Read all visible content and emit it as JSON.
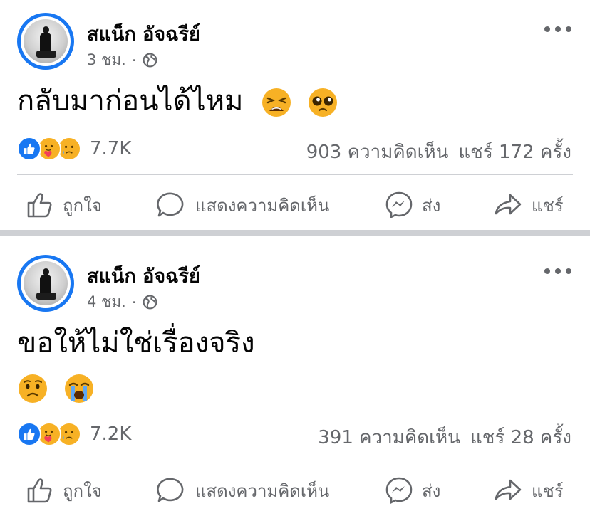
{
  "posts": [
    {
      "author": "สแน็ก อัจฉรีย์",
      "time": "3 ชม.",
      "dot": "·",
      "text": "กลับมาก่อนได้ไหม",
      "emojis": [
        "weary-face",
        "pleading-face"
      ],
      "reaction_count": "7.7K",
      "comments": "903 ความคิดเห็น",
      "shares": "แชร์ 172 ครั้ง"
    },
    {
      "author": "สแน็ก อัจฉรีย์",
      "time": "4 ชม.",
      "dot": "·",
      "text": "ขอให้ไม่ใช่เรื่องจริง",
      "emojis": [
        "worried-face",
        "loudly-crying-face"
      ],
      "reaction_count": "7.2K",
      "comments": "391 ความคิดเห็น",
      "shares": "แชร์ 28 ครั้ง"
    }
  ],
  "actions": {
    "like": "ถูกใจ",
    "comment": "แสดงความคิดเห็น",
    "send": "ส่ง",
    "share": "แชร์"
  },
  "reactions": [
    "like-reaction-icon",
    "care-reaction-icon",
    "sad-reaction-icon"
  ],
  "colors": {
    "brand_blue": "#1877f2",
    "secondary_text": "#65676b",
    "divider": "#ced0d4",
    "emoji_yellow": "#f7b125"
  }
}
